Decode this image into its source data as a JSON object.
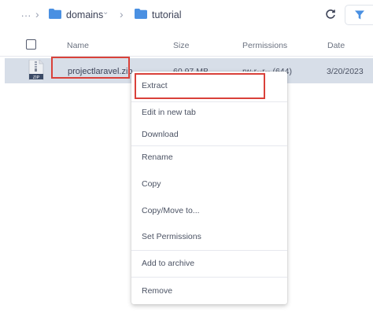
{
  "breadcrumb": {
    "ellipsis": "...",
    "items": [
      {
        "label": "domains"
      },
      {
        "label": "tutorial"
      }
    ]
  },
  "table": {
    "columns": [
      "Name",
      "Size",
      "Permissions",
      "Date"
    ],
    "rows": [
      {
        "name": "projectlaravel.zip",
        "size": "60.97 MB",
        "permissions": "rw-r--r-- (644)",
        "date": "3/20/2023",
        "icon_text": "ZIP"
      }
    ]
  },
  "context_menu": {
    "items": [
      "Extract",
      "Edit in new tab",
      "Download",
      "Rename",
      "Copy",
      "Copy/Move to...",
      "Set Permissions",
      "Add to archive",
      "Remove"
    ]
  },
  "colors": {
    "folder": "#4a90e2",
    "highlight_border": "#d9413a",
    "selected_row": "#d7dee8"
  }
}
